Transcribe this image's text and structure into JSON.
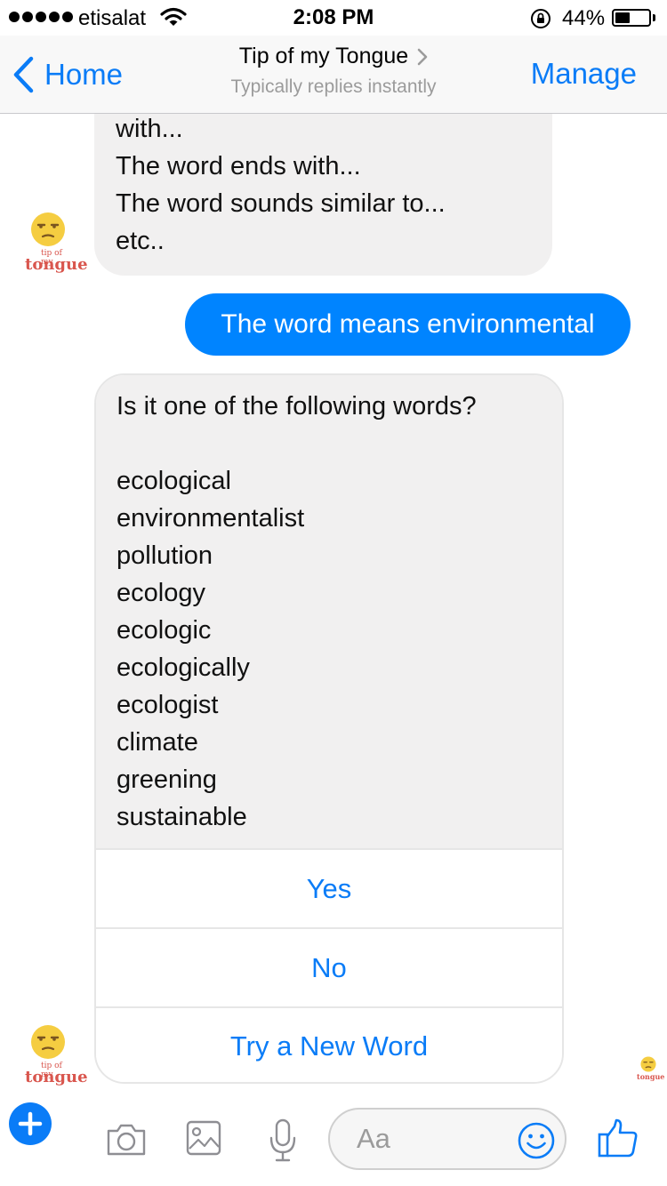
{
  "status_bar": {
    "carrier": "etisalat",
    "time": "2:08 PM",
    "battery_percent": "44%",
    "battery_level": 0.44
  },
  "nav": {
    "back_label": "Home",
    "title": "Tip of my Tongue",
    "subtitle": "Typically replies instantly",
    "manage_label": "Manage"
  },
  "avatar": {
    "logo_small_text": "tip of my",
    "logo_word": "tongue"
  },
  "messages": {
    "intro_lines": [
      "with...",
      "The word ends with...",
      "The word sounds similar to...",
      "etc.."
    ],
    "user_message": "The word means environmental",
    "question": "Is it one of the following words?",
    "words": [
      "ecological",
      "environmentalist",
      "pollution",
      "ecology",
      "ecologic",
      "ecologically",
      "ecologist",
      "climate",
      "greening",
      "sustainable"
    ],
    "buttons": {
      "yes": "Yes",
      "no": "No",
      "try_new": "Try a New Word"
    }
  },
  "composer": {
    "placeholder": "Aa"
  },
  "colors": {
    "accent": "#0a7cf7",
    "outgoing_bubble": "#0084ff",
    "incoming_bubble": "#f1f0f0",
    "logo_text": "#d9564e",
    "emoji_face": "#f5cd41"
  },
  "icons": {
    "status": [
      "signal-dots-icon",
      "wifi-icon",
      "orientation-lock-icon",
      "battery-icon"
    ],
    "nav": [
      "chevron-left-icon",
      "chevron-right-icon"
    ],
    "composer": [
      "plus-icon",
      "camera-icon",
      "photo-icon",
      "microphone-icon",
      "emoji-icon",
      "thumbs-up-icon"
    ]
  }
}
